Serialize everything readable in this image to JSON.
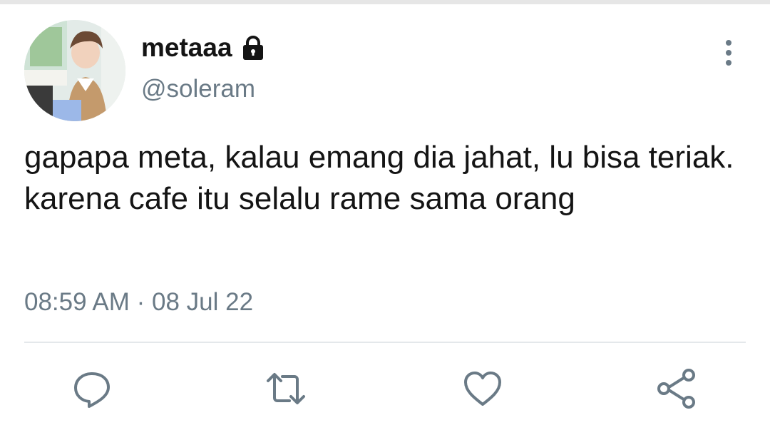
{
  "tweet": {
    "display_name": "metaa",
    "display_name_tail": "a",
    "handle": "@soleram",
    "text": "gapapa meta, kalau emang dia jahat, lu bisa teriak. karena cafe itu selalu rame sama orang",
    "timestamp": "08:59 AM · 08 Jul 22",
    "protected": true
  },
  "icons": {
    "lock": "lock-icon",
    "more": "more-vertical-icon",
    "reply": "reply-icon",
    "retweet": "retweet-icon",
    "like": "heart-icon",
    "share": "share-icon"
  },
  "colors": {
    "text_primary": "#141414",
    "text_secondary": "#6a7a86",
    "icon": "#6a7a86",
    "divider": "#e4e8eb"
  }
}
